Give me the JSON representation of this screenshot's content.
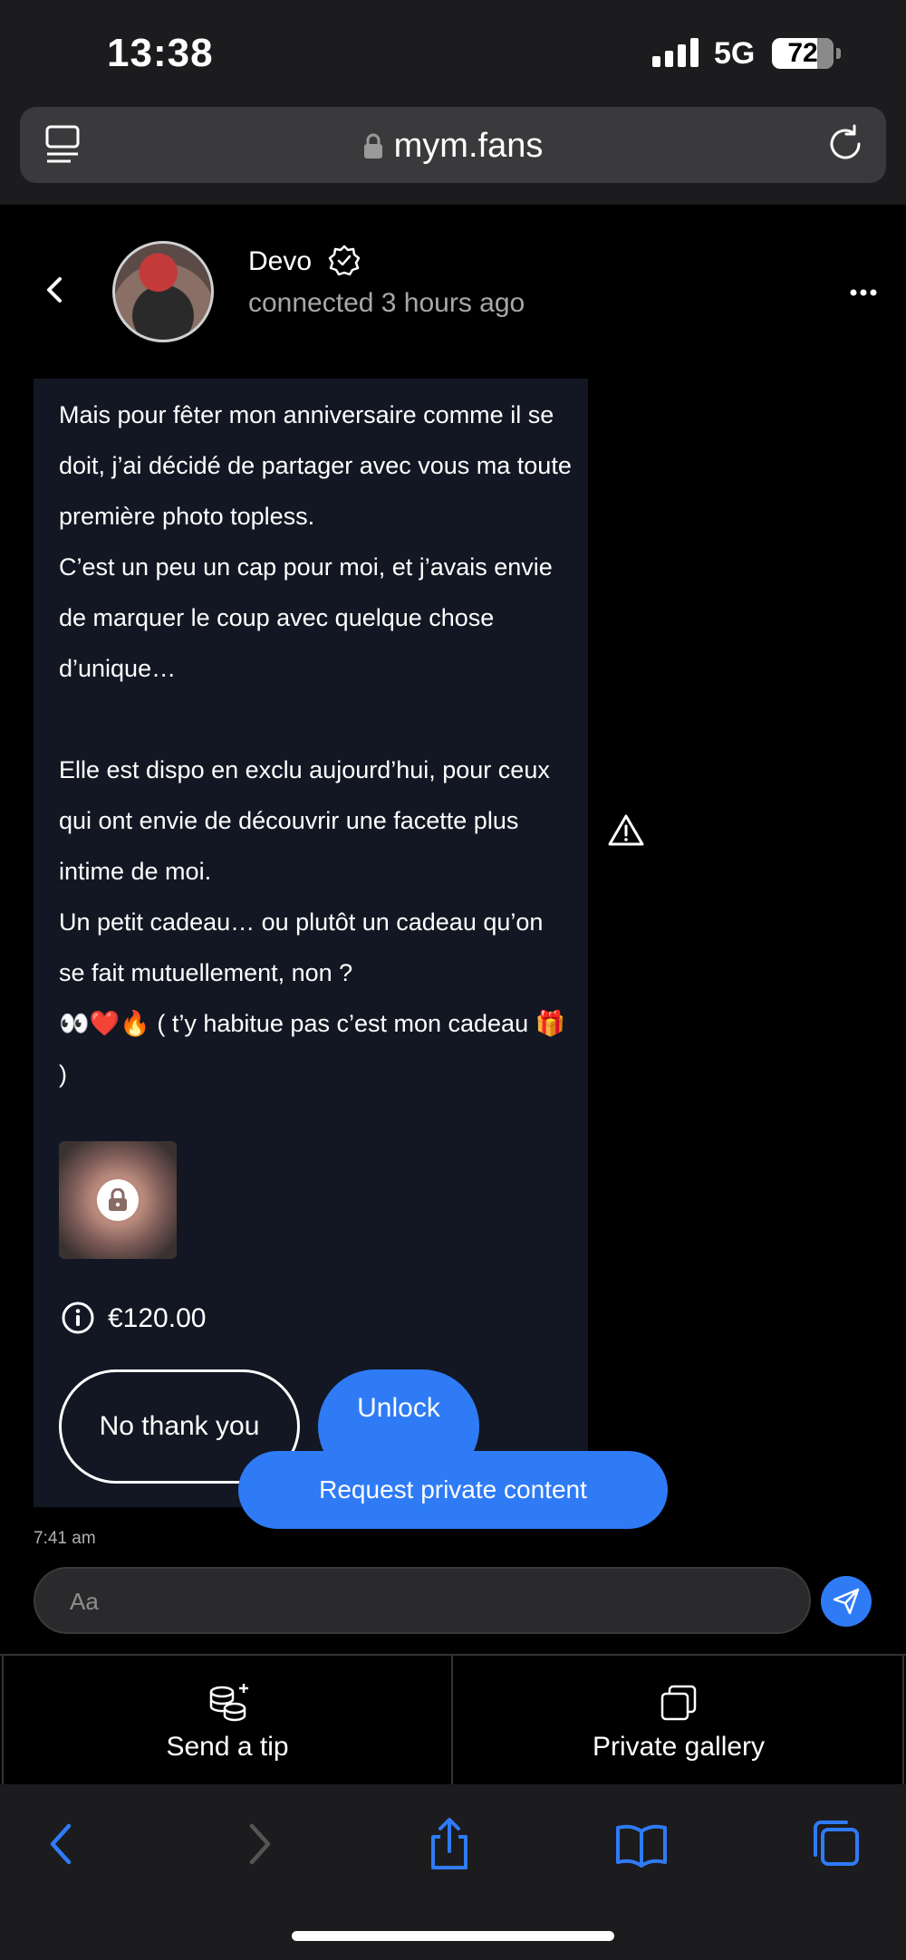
{
  "status_bar": {
    "time": "13:38",
    "network": "5G",
    "battery": "72"
  },
  "browser": {
    "url": "mym.fans"
  },
  "chat_header": {
    "name": "Devo",
    "last_seen": "connected 3 hours ago"
  },
  "message": {
    "paragraphs": [
      "Mais pour fêter mon anniversaire comme il se doit, j’ai décidé de partager avec vous ma toute première photo topless.",
      "C’est un peu un cap pour moi, et j’avais envie de marquer le coup avec quelque chose d’unique…",
      "",
      "Elle est dispo en exclu aujourd’hui, pour ceux qui ont envie de découvrir une facette plus intime de moi.",
      "Un petit cadeau… ou plutôt un cadeau qu’on se fait mutuellement, non ?",
      "👀❤️🔥 ( t’y habitue pas c’est mon cadeau 🎁 )"
    ],
    "price": "€120.00",
    "decline_label": "No thank you",
    "unlock_label": "Unlock",
    "time": "7:41 am"
  },
  "request_button": "Request private content",
  "composer": {
    "placeholder": "Aa"
  },
  "actions": {
    "tip_label": "Send a tip",
    "gallery_label": "Private gallery"
  },
  "colors": {
    "accent": "#2f7bf6",
    "bubble": "#121723",
    "background": "#000000"
  }
}
